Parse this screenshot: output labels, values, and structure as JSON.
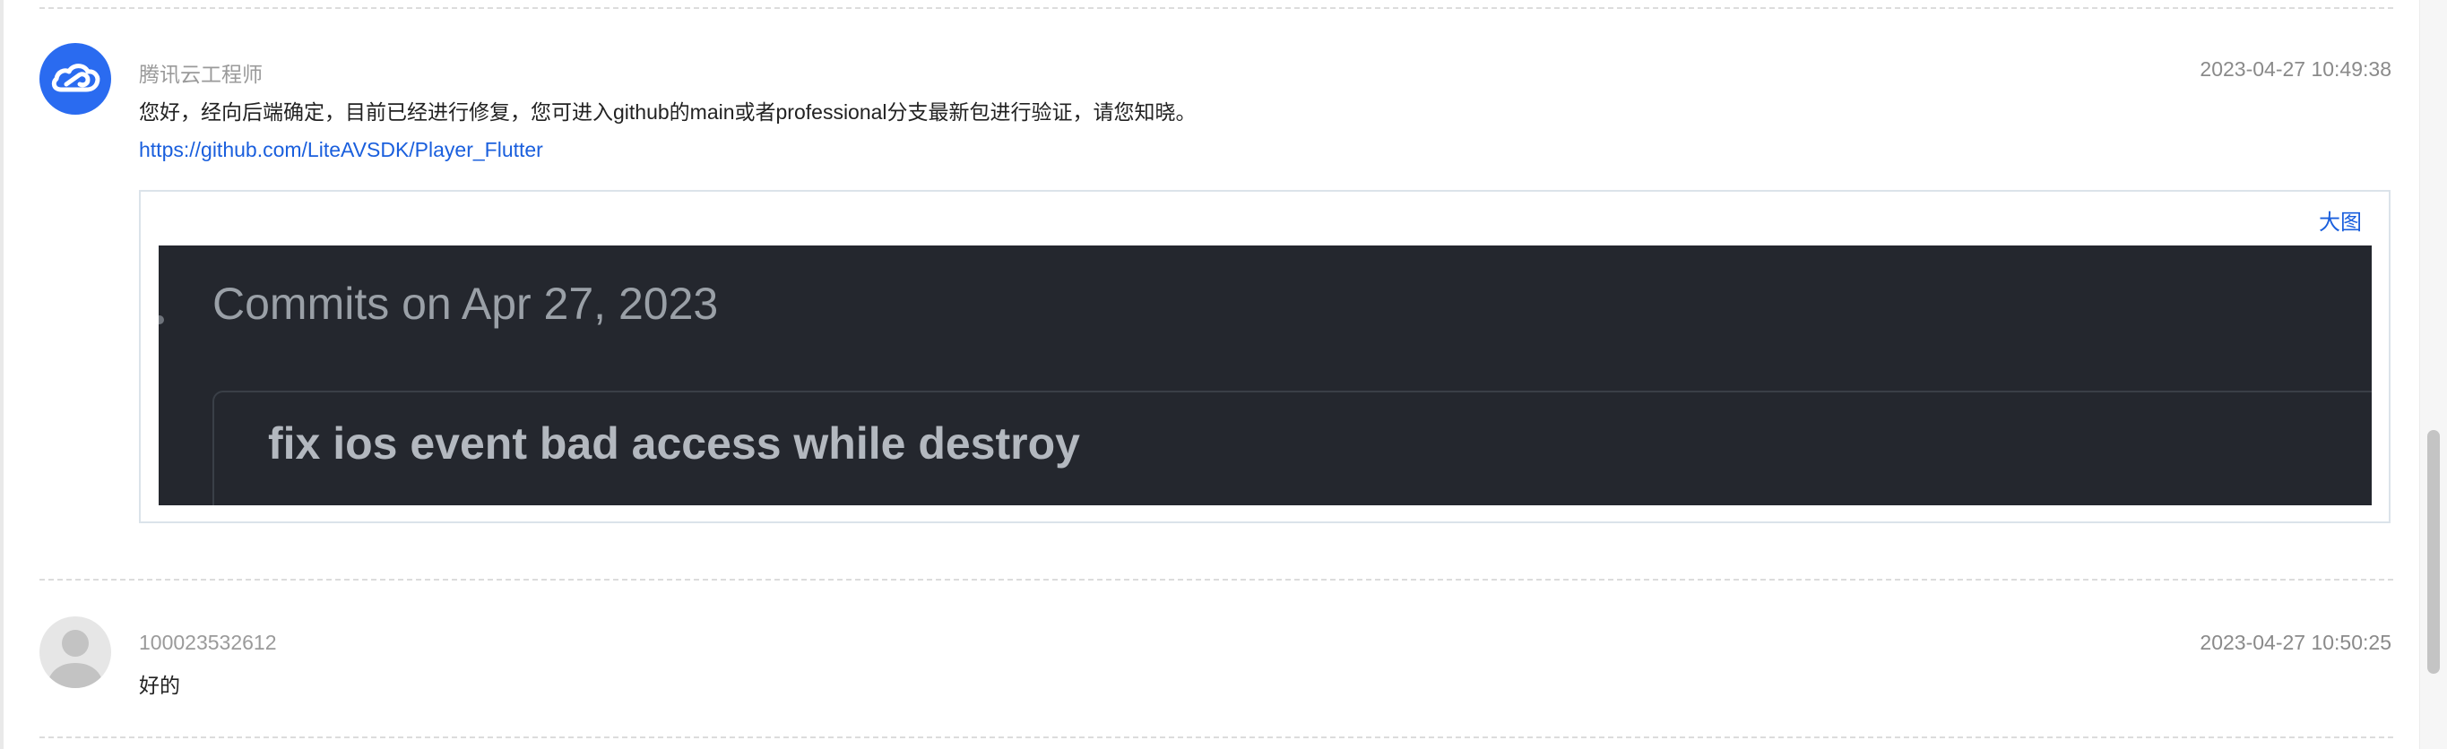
{
  "thread": {
    "messages": [
      {
        "author": "腾讯云工程师",
        "timestamp": "2023-04-27 10:49:38",
        "avatar_icon": "tencent-cloud-logo-icon",
        "text": "您好，经向后端确定，目前已经进行修复，您可进入github的main或者professional分支最新包进行验证，请您知晓。",
        "link": "https://github.com/LiteAVSDK/Player_Flutter",
        "attachment": {
          "enlarge_label": "大图",
          "screenshot": {
            "heading": "Commits on Apr 27, 2023",
            "commit_title": "fix ios event bad access while destroy"
          }
        }
      },
      {
        "author": "100023532612",
        "timestamp": "2023-04-27 10:50:25",
        "avatar_icon": "default-user-avatar-icon",
        "text": "好的"
      }
    ]
  },
  "colors": {
    "accent_blue": "#2a6bf0",
    "link_blue": "#1a5fdd",
    "screenshot_bg": "#24272e"
  }
}
